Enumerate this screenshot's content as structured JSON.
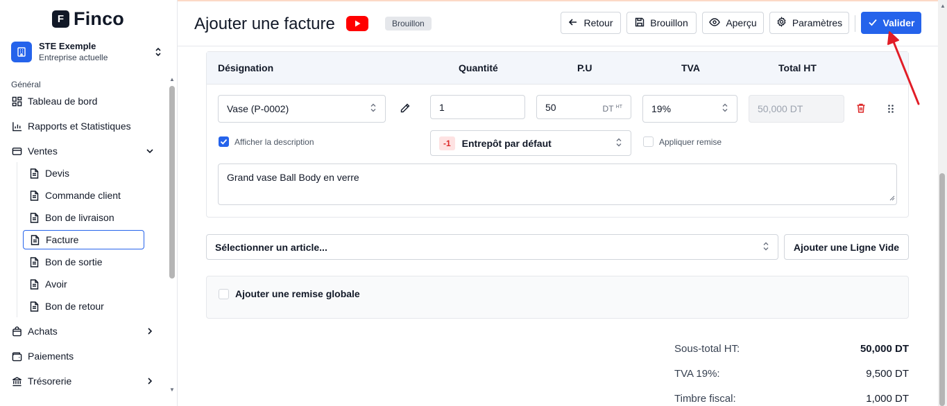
{
  "brand": {
    "logo_letter": "F",
    "name": "Finco"
  },
  "company": {
    "name": "STE Exemple",
    "subtitle": "Entreprise actuelle"
  },
  "sidebar": {
    "section_label": "Général",
    "items": [
      {
        "label": "Tableau de bord",
        "icon": "dashboard-icon"
      },
      {
        "label": "Rapports et Statistiques",
        "icon": "bar-chart-icon"
      },
      {
        "label": "Ventes",
        "icon": "credit-card-icon",
        "expanded": true
      },
      {
        "label": "Achats",
        "icon": "shopping-bag-icon"
      },
      {
        "label": "Paiements",
        "icon": "wallet-icon"
      },
      {
        "label": "Trésorerie",
        "icon": "bank-icon"
      }
    ],
    "sub_items": [
      {
        "label": "Devis"
      },
      {
        "label": "Commande client"
      },
      {
        "label": "Bon de livraison"
      },
      {
        "label": "Facture",
        "active": true
      },
      {
        "label": "Bon de sortie"
      },
      {
        "label": "Avoir"
      },
      {
        "label": "Bon de retour"
      }
    ]
  },
  "header": {
    "title": "Ajouter une facture",
    "status_badge": "Brouillon",
    "buttons": {
      "back": "Retour",
      "draft": "Brouillon",
      "preview": "Aperçu",
      "settings": "Paramètres",
      "validate": "Valider"
    }
  },
  "table": {
    "columns": [
      "Désignation",
      "Quantité",
      "P.U",
      "TVA",
      "Total HT"
    ],
    "row": {
      "product": "Vase (P-0002)",
      "quantity": "1",
      "unit_price": "50",
      "currency": "DT",
      "currency_sup": "HT",
      "tva": "19%",
      "total_ht": "50,000 DT",
      "show_description_label": "Afficher la description",
      "show_description_checked": true,
      "stock_badge": "-1",
      "warehouse": "Entrepôt par défaut",
      "apply_discount_label": "Appliquer remise",
      "apply_discount_checked": false,
      "description": "Grand vase Ball Body en verre"
    }
  },
  "article_select": {
    "placeholder": "Sélectionner un article..."
  },
  "add_empty_line": "Ajouter une Ligne Vide",
  "global_discount": {
    "label": "Ajouter une remise globale",
    "checked": false
  },
  "totals": [
    {
      "label": "Sous-total HT:",
      "value": "50,000 DT",
      "bold": true
    },
    {
      "label": "TVA 19%:",
      "value": "9,500 DT"
    },
    {
      "label": "Timbre fiscal:",
      "value": "1,000 DT"
    }
  ],
  "colors": {
    "primary": "#2563eb",
    "danger": "#dc2626",
    "annotation_arrow": "#e11d27"
  }
}
